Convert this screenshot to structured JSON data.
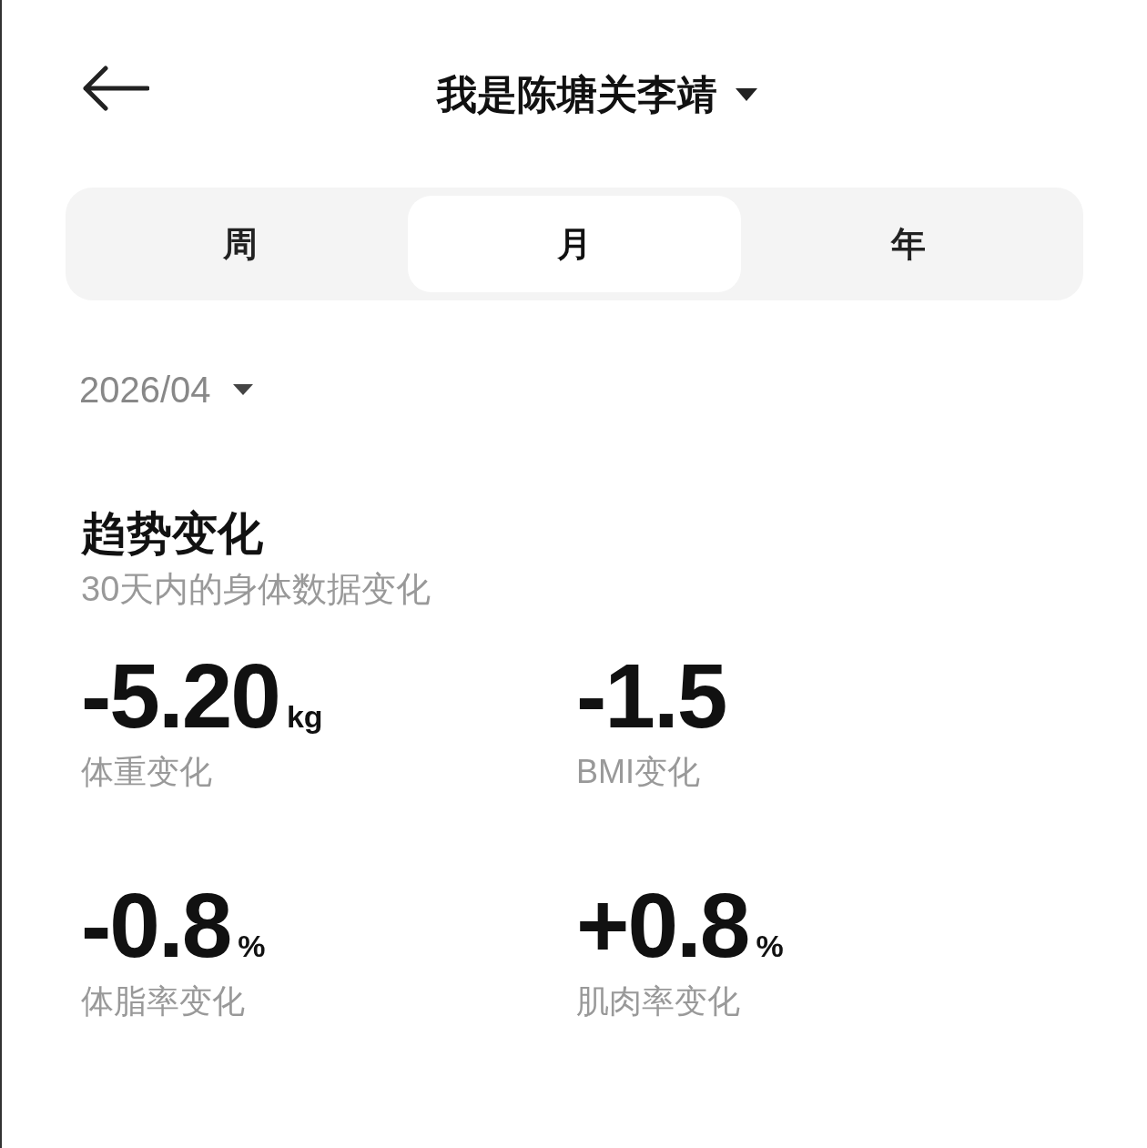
{
  "header": {
    "title": "我是陈塘关李靖"
  },
  "tabs": [
    {
      "label": "周",
      "selected": false
    },
    {
      "label": "月",
      "selected": true
    },
    {
      "label": "年",
      "selected": false
    }
  ],
  "date_picker": {
    "value": "2026/04"
  },
  "trend": {
    "title": "趋势变化",
    "subtitle": "30天内的身体数据变化",
    "stats": [
      {
        "value": "-5.20",
        "unit": "kg",
        "label": "体重变化"
      },
      {
        "value": "-1.5",
        "label": "BMI变化"
      },
      {
        "value": "-0.8",
        "unit": "%",
        "label": "体脂率变化"
      },
      {
        "value": "+0.8",
        "unit": "%",
        "label": "肌肉率变化"
      }
    ]
  }
}
